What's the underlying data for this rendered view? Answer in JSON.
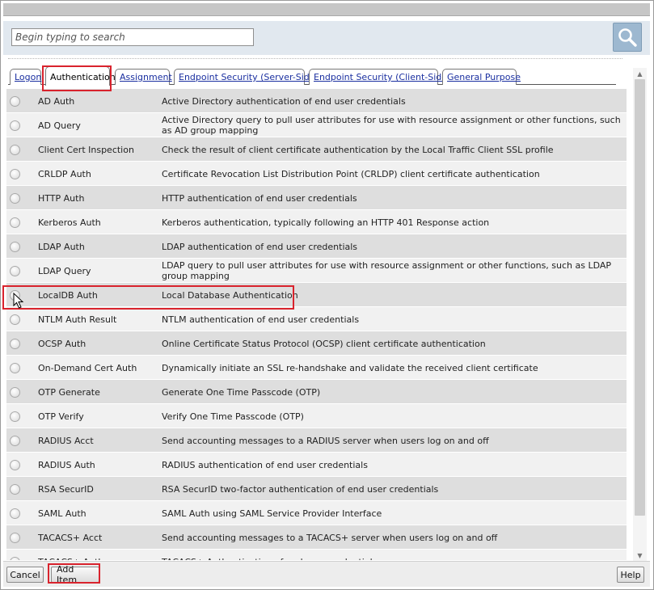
{
  "search": {
    "placeholder": "Begin typing to search"
  },
  "tabs": [
    {
      "label": "Logon"
    },
    {
      "label": "Authentication",
      "active": true
    },
    {
      "label": "Assignment"
    },
    {
      "label": "Endpoint Security (Server-Side)"
    },
    {
      "label": "Endpoint Security (Client-Side)"
    },
    {
      "label": "General Purpose"
    }
  ],
  "items": [
    {
      "name": "AD Auth",
      "description": "Active Directory authentication of end user credentials"
    },
    {
      "name": "AD Query",
      "description": "Active Directory query to pull user attributes for use with resource assignment or other functions, such as AD group mapping"
    },
    {
      "name": "Client Cert Inspection",
      "description": "Check the result of client certificate authentication by the Local Traffic Client SSL profile"
    },
    {
      "name": "CRLDP Auth",
      "description": "Certificate Revocation List Distribution Point (CRLDP) client certificate authentication"
    },
    {
      "name": "HTTP Auth",
      "description": "HTTP authentication of end user credentials"
    },
    {
      "name": "Kerberos Auth",
      "description": "Kerberos authentication, typically following an HTTP 401 Response action"
    },
    {
      "name": "LDAP Auth",
      "description": "LDAP authentication of end user credentials"
    },
    {
      "name": "LDAP Query",
      "description": "LDAP query to pull user attributes for use with resource assignment or other functions, such as LDAP group mapping"
    },
    {
      "name": "LocalDB Auth",
      "description": "Local Database Authentication",
      "highlighted": true
    },
    {
      "name": "NTLM Auth Result",
      "description": "NTLM authentication of end user credentials"
    },
    {
      "name": "OCSP Auth",
      "description": "Online Certificate Status Protocol (OCSP) client certificate authentication"
    },
    {
      "name": "On-Demand Cert Auth",
      "description": "Dynamically initiate an SSL re-handshake and validate the received client certificate"
    },
    {
      "name": "OTP Generate",
      "description": "Generate One Time Passcode (OTP)"
    },
    {
      "name": "OTP Verify",
      "description": "Verify One Time Passcode (OTP)"
    },
    {
      "name": "RADIUS Acct",
      "description": "Send accounting messages to a RADIUS server when users log on and off"
    },
    {
      "name": "RADIUS Auth",
      "description": "RADIUS authentication of end user credentials"
    },
    {
      "name": "RSA SecurID",
      "description": "RSA SecurID two-factor authentication of end user credentials"
    },
    {
      "name": "SAML Auth",
      "description": "SAML Auth using SAML Service Provider Interface"
    },
    {
      "name": "TACACS+ Acct",
      "description": "Send accounting messages to a TACACS+ server when users log on and off"
    },
    {
      "name": "TACACS+ Auth",
      "description": "TACACS+ Authentication of end user credentials"
    }
  ],
  "footer": {
    "cancel_label": "Cancel",
    "add_label": "Add Item",
    "help_label": "Help"
  },
  "colors": {
    "highlight": "#d9232d",
    "tab_link": "#1a2fa0",
    "search_bar": "#e1e8ef"
  }
}
